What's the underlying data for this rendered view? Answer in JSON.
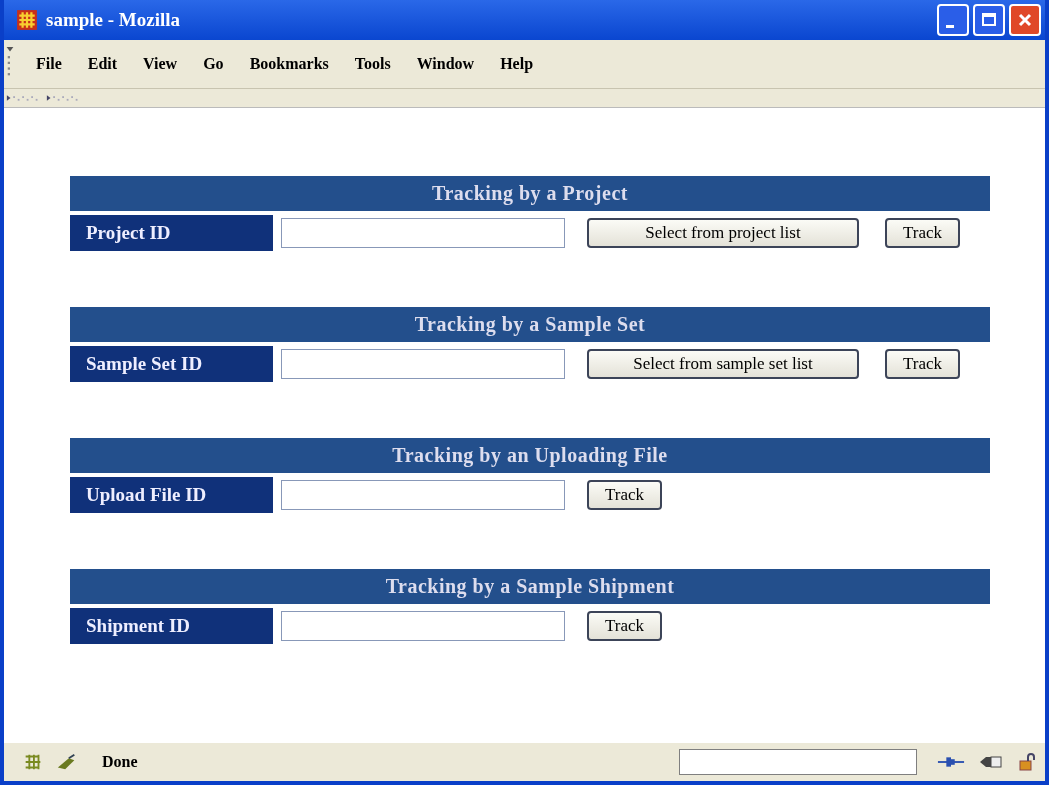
{
  "window": {
    "title": "sample - Mozilla"
  },
  "menu": [
    "File",
    "Edit",
    "View",
    "Go",
    "Bookmarks",
    "Tools",
    "Window",
    "Help"
  ],
  "sections": [
    {
      "title": "Tracking by a Project",
      "label": "Project ID",
      "buttons": [
        "Select from project list",
        "Track"
      ]
    },
    {
      "title": "Tracking by a Sample Set",
      "label": "Sample Set ID",
      "buttons": [
        "Select from sample set list",
        "Track"
      ]
    },
    {
      "title": "Tracking by an Uploading File",
      "label": "Upload File ID",
      "buttons": [
        "Track"
      ]
    },
    {
      "title": "Tracking by a Sample Shipment",
      "label": "Shipment ID",
      "buttons": [
        "Track"
      ]
    }
  ],
  "status_bar": {
    "text": "Done"
  }
}
